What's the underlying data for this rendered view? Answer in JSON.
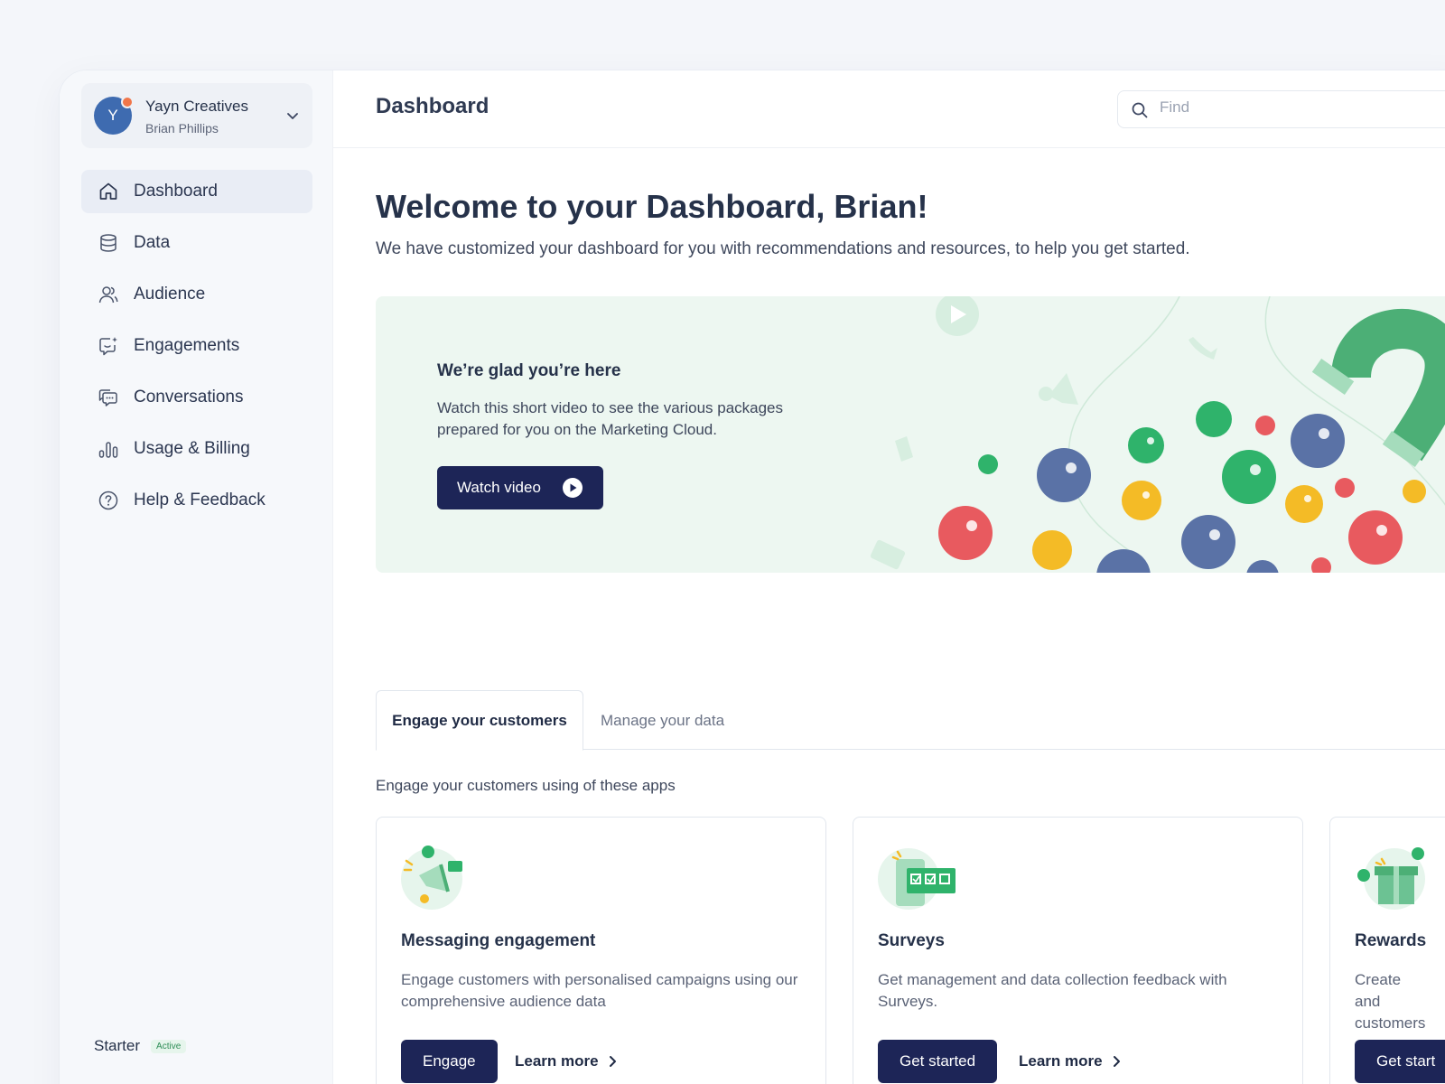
{
  "account": {
    "initial": "Y",
    "name": "Yayn Creatives",
    "user": "Brian Phillips"
  },
  "sidebar": {
    "items": [
      {
        "label": "Dashboard",
        "icon": "home-icon",
        "active": true
      },
      {
        "label": "Data",
        "icon": "database-icon",
        "active": false
      },
      {
        "label": "Audience",
        "icon": "users-icon",
        "active": false
      },
      {
        "label": "Engagements",
        "icon": "chat-sparkle-icon",
        "active": false
      },
      {
        "label": "Conversations",
        "icon": "chat-bubbles-icon",
        "active": false
      },
      {
        "label": "Usage & Billing",
        "icon": "bar-chart-icon",
        "active": false
      },
      {
        "label": "Help & Feedback",
        "icon": "question-icon",
        "active": false
      }
    ],
    "plan": {
      "name": "Starter",
      "badge": "Active"
    }
  },
  "header": {
    "title": "Dashboard",
    "search_placeholder": "Find"
  },
  "welcome": {
    "title": "Welcome to your Dashboard, Brian!",
    "subtitle": "We have customized your dashboard for you with recommendations and resources, to help you get started."
  },
  "hero": {
    "title": "We’re glad you’re here",
    "text": "Watch this short video to see the various packages prepared for you on the Marketing Cloud.",
    "button": "Watch video"
  },
  "tabs": [
    {
      "label": "Engage your customers",
      "active": true
    },
    {
      "label": "Manage your data",
      "active": false
    }
  ],
  "section_text": "Engage your customers using of these apps",
  "cards": [
    {
      "title": "Messaging engagement",
      "text": "Engage customers with personalised campaigns using our comprehensive audience data",
      "button": "Engage",
      "link": "Learn more"
    },
    {
      "title": "Surveys",
      "text": "Get management and data collection feedback with Surveys.",
      "button": "Get started",
      "link": "Learn more"
    },
    {
      "title": "Rewards",
      "text": "Create and customers",
      "button": "Get start",
      "link": ""
    }
  ],
  "colors": {
    "primary": "#1d2557",
    "accent_green": "#2fb36b",
    "hero_bg": "#edf7f1",
    "sidebar_bg": "#f6f8fb"
  }
}
